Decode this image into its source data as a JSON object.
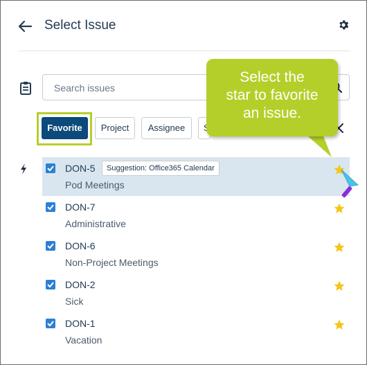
{
  "header": {
    "title": "Select Issue"
  },
  "search": {
    "placeholder": "Search issues"
  },
  "filters": [
    {
      "label": "Favorite"
    },
    {
      "label": "Project"
    },
    {
      "label": "Assignee"
    },
    {
      "label": "S"
    }
  ],
  "issues": [
    {
      "key": "DON-5",
      "summary": "Pod Meetings",
      "badge": "Suggestion: Office365 Calendar",
      "checked": true,
      "favorite": true
    },
    {
      "key": "DON-7",
      "summary": "Administrative",
      "checked": true,
      "favorite": true
    },
    {
      "key": "DON-6",
      "summary": "Non-Project Meetings",
      "checked": true,
      "favorite": true
    },
    {
      "key": "DON-2",
      "summary": "Sick",
      "checked": true,
      "favorite": true
    },
    {
      "key": "DON-1",
      "summary": "Vacation",
      "checked": true,
      "favorite": true
    }
  ],
  "callout": {
    "line1": "Select the",
    "line2": "star to favorite",
    "line3": "an issue."
  },
  "colors": {
    "accent": "#0b4a7a",
    "checkbox": "#2d7fd6",
    "star": "#f5c518",
    "callout": "#b5cf2a",
    "selected_row": "#d9e6ef"
  }
}
